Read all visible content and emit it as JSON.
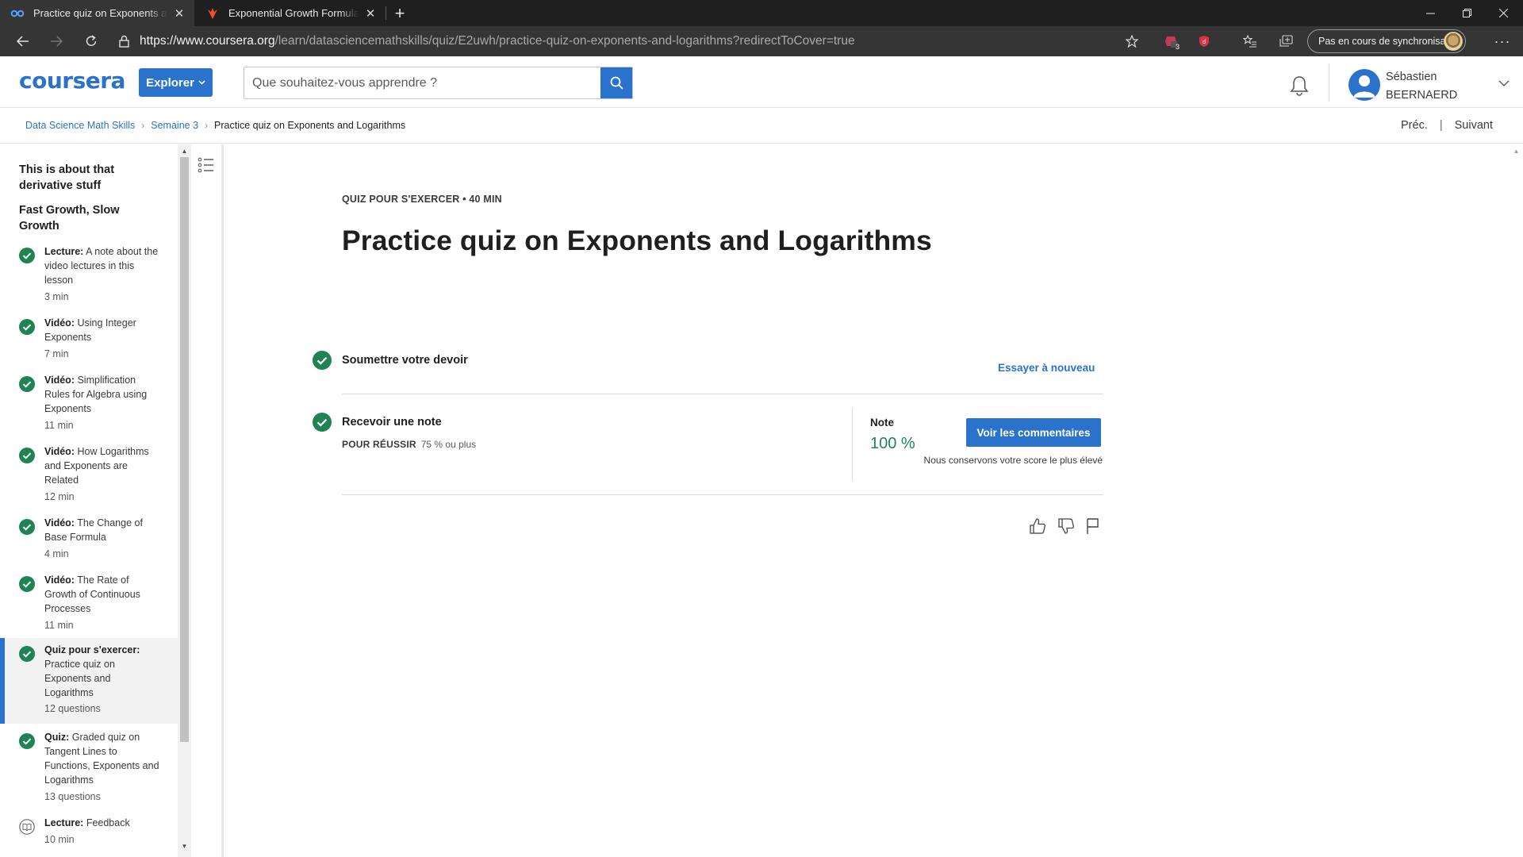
{
  "browser": {
    "tabs": [
      {
        "title": "Practice quiz on Exponents and Logarithms | Coursera",
        "active": true
      },
      {
        "title": "Exponential Growth Formula | Study.com",
        "active": false
      }
    ],
    "url_host": "https://www.coursera.org",
    "url_path": "/learn/datasciencemathskills/quiz/E2uwh/practice-quiz-on-exponents-and-logarithms?redirectToCover=true",
    "extension_badge": "3",
    "sync_label": "Pas en cours de synchronisation"
  },
  "header": {
    "logo": "coursera",
    "explore_label": "Explorer",
    "search_placeholder": "Que souhaitez-vous apprendre ?",
    "user_first": "Sébastien",
    "user_last": "BEERNAERD"
  },
  "breadcrumb": {
    "items": [
      "Data Science Math Skills",
      "Semaine 3",
      "Practice quiz on Exponents and Logarithms"
    ],
    "prev": "Préc.",
    "next": "Suivant"
  },
  "sidebar": {
    "headings": [
      "This is about that derivative stuff",
      "Fast Growth, Slow Growth"
    ],
    "items": [
      {
        "type": "Lecture:",
        "title": "A note about the video lectures in this lesson",
        "meta": "3  min",
        "status": "done"
      },
      {
        "type": "Vidéo:",
        "title": "Using Integer Exponents",
        "meta": "7  min",
        "status": "done"
      },
      {
        "type": "Vidéo:",
        "title": "Simplification Rules for Algebra using Exponents",
        "meta": "11  min",
        "status": "done"
      },
      {
        "type": "Vidéo:",
        "title": "How Logarithms and Exponents are Related",
        "meta": "12  min",
        "status": "done"
      },
      {
        "type": "Vidéo:",
        "title": "The Change of Base Formula",
        "meta": "4  min",
        "status": "done"
      },
      {
        "type": "Vidéo:",
        "title": "The Rate of Growth of Continuous Processes",
        "meta": "11  min",
        "status": "done"
      },
      {
        "type": "Quiz pour s'exercer:",
        "title": "Practice quiz on Exponents and Logarithms",
        "meta": "12 questions",
        "status": "done"
      },
      {
        "type": "Quiz:",
        "title": "Graded quiz on Tangent Lines to Functions, Exponents and Logarithms",
        "meta": "13 questions",
        "status": "done"
      },
      {
        "type": "Lecture:",
        "title": "Feedback",
        "meta": "10  min",
        "status": "todo"
      }
    ]
  },
  "main": {
    "kicker": "QUIZ POUR S'EXERCER • 40  MIN",
    "title": "Practice quiz on Exponents and Logarithms",
    "step1_label": "Soumettre votre devoir",
    "retry_label": "Essayer à nouveau",
    "step2_label": "Recevoir une note",
    "pass_label": "POUR RÉUSSIR",
    "pass_value": "75 % ou plus",
    "grade_label": "Note",
    "grade_value": "100 %",
    "feedback_button": "Voir les commentaires",
    "score_note": "Nous conservons votre score le plus élevé"
  },
  "colors": {
    "brand": "#2a73cc",
    "success": "#1f8354",
    "chrome_dark": "#1f1f1f",
    "chrome_bar": "#353535"
  }
}
